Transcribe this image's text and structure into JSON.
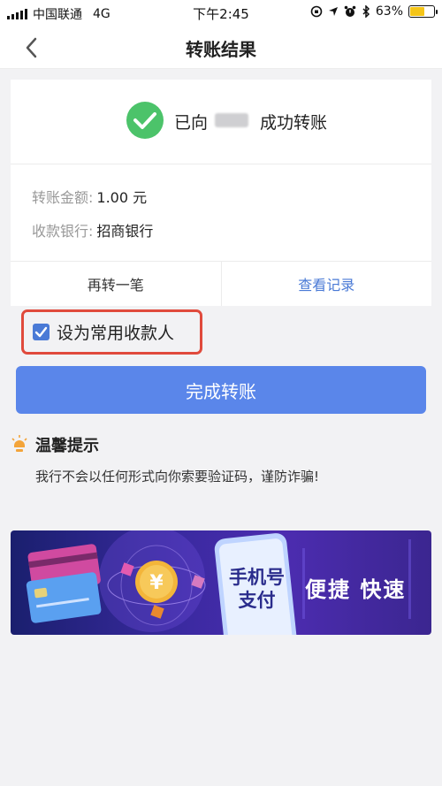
{
  "status_bar": {
    "carrier": "中国联通",
    "network": "4G",
    "time": "下午2:45",
    "battery_percent": "63%",
    "battery_level": 0.63
  },
  "nav": {
    "title": "转账结果",
    "back_icon": "chevron-left-icon"
  },
  "result": {
    "icon": "success-check-icon",
    "prefix": "已向",
    "suffix": "成功转账",
    "color": "#4cc36a"
  },
  "details": [
    {
      "label": "转账金额:",
      "value": "1.00 元"
    },
    {
      "label": "收款银行:",
      "value": "招商银行"
    }
  ],
  "actions": {
    "again": "再转一笔",
    "records": "查看记录"
  },
  "favorite": {
    "label": "设为常用收款人",
    "checked": true
  },
  "primary_button": {
    "label": "完成转账",
    "color": "#5a86ea"
  },
  "tips": {
    "icon": "lightbulb-icon",
    "title": "温馨提示",
    "text": "我行不会以任何形式向你索要验证码，谨防诈骗!"
  },
  "banner": {
    "phone_text_line1": "手机号",
    "phone_text_line2": "支付",
    "slogan": "便捷 快速"
  },
  "colors": {
    "accent": "#4a7ad6",
    "highlight_border": "#e04a3c"
  }
}
